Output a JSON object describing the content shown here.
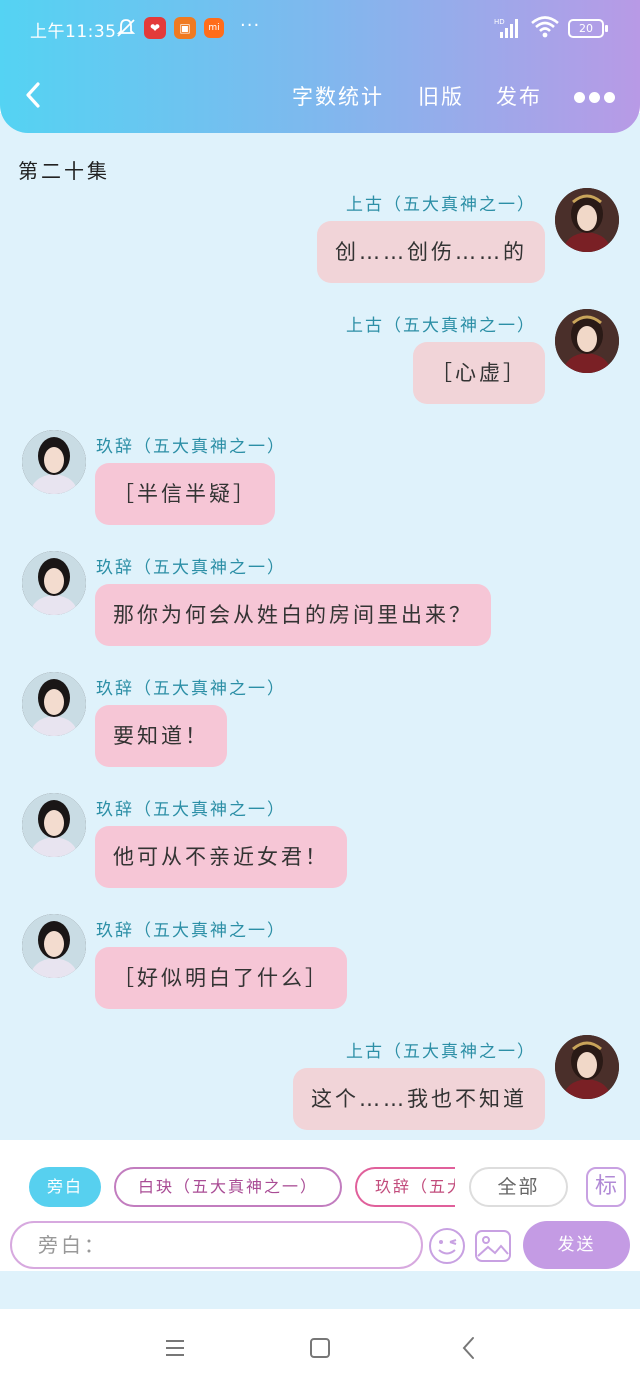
{
  "status_bar": {
    "time": "上午11:35",
    "dots": "···",
    "battery": "20",
    "hd_label": "HD",
    "mi_label": "mi"
  },
  "header": {
    "actions": [
      "字数统计",
      "旧版",
      "发布"
    ]
  },
  "chapter_title": "第二十集",
  "messages": [
    {
      "side": "right",
      "speaker": "上古（五大真神之一）",
      "text": "创……创伤……的"
    },
    {
      "side": "right",
      "speaker": "上古（五大真神之一）",
      "text": "［心虚］"
    },
    {
      "side": "left",
      "speaker": "玖辞（五大真神之一）",
      "text": "［半信半疑］"
    },
    {
      "side": "left",
      "speaker": "玖辞（五大真神之一）",
      "text": "那你为何会从姓白的房间里出来？"
    },
    {
      "side": "left",
      "speaker": "玖辞（五大真神之一）",
      "text": "要知道！"
    },
    {
      "side": "left",
      "speaker": "玖辞（五大真神之一）",
      "text": "他可从不亲近女君！"
    },
    {
      "side": "left",
      "speaker": "玖辞（五大真神之一）",
      "text": "［好似明白了什么］"
    },
    {
      "side": "right",
      "speaker": "上古（五大真神之一）",
      "text": "这个……我也不知道"
    }
  ],
  "role_chips": {
    "narration": "旁白",
    "baijue": "白玦（五大真神之一）",
    "jiuci": "玖辞（五大真神之一）",
    "all": "全部",
    "mark": "标"
  },
  "input": {
    "placeholder": "旁白：",
    "value": ""
  },
  "send_label": "发送",
  "colors": {
    "header_gradient_start": "#54d3f3",
    "header_gradient_end": "#b89ae6",
    "chat_background": "#dff2fb",
    "speaker_text": "#2c8fa6",
    "bubble_right": "#f1d4d8",
    "bubble_left": "#f6c6d6",
    "send_button": "#c49be4",
    "narration_chip": "#57d0ef"
  },
  "icons": {
    "back": "chevron-left-icon",
    "more": "more-dots-icon",
    "emoji": "emoji-wink-icon",
    "image": "image-icon",
    "nav_menu": "menu-lines-icon",
    "nav_home": "square-home-icon",
    "nav_back": "chevron-left-icon"
  }
}
